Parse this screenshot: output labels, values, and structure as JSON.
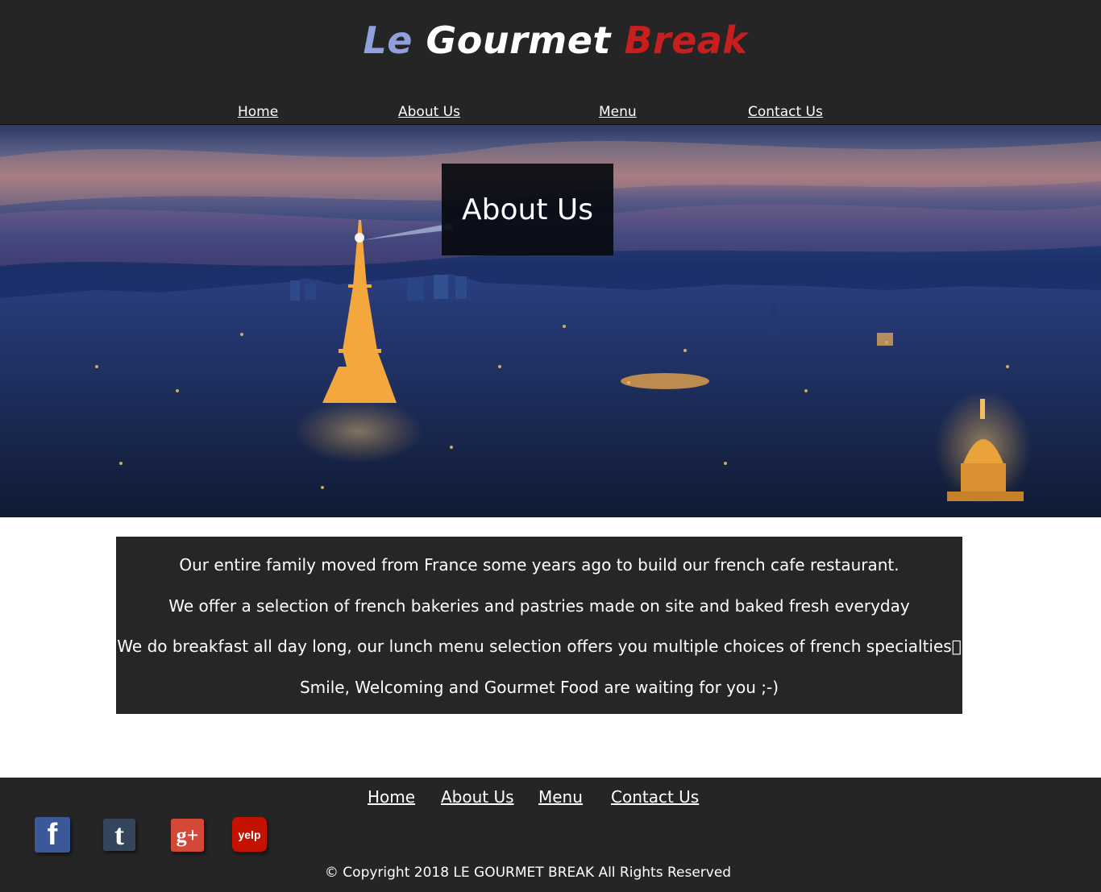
{
  "brand": {
    "word1": "Le",
    "word2": "Gourmet",
    "word3": "Break",
    "colors": {
      "word1": "#8fa0dc",
      "word2": "#ffffff",
      "word3": "#c81e1e"
    }
  },
  "nav": {
    "home": "Home",
    "about": "About Us",
    "menu": "Menu",
    "contact": "Contact Us"
  },
  "hero": {
    "title": "About Us"
  },
  "about": {
    "paragraphs": [
      "Our entire family moved from France some years ago to build our french cafe restaurant.",
      "We offer a selection of french bakeries and pastries made on site and baked fresh everyday",
      "We do breakfast all day long, our lunch menu selection offers you multiple choices of french specialties\u0000",
      "Smile, Welcoming and Gourmet Food are waiting for you ;-)"
    ]
  },
  "footer": {
    "nav": {
      "home": "Home",
      "about": "About Us",
      "menu": "Menu",
      "contact": "Contact Us"
    },
    "social": {
      "facebook": "f",
      "tumblr": "t",
      "googleplus": "g+",
      "yelp": "yelp"
    },
    "copyright": "© Copyright 2018 LE GOURMET BREAK All Rights Reserved"
  },
  "theme": {
    "header_bg": "#252525",
    "about_bg": "#262626",
    "footer_bg": "#252525"
  }
}
